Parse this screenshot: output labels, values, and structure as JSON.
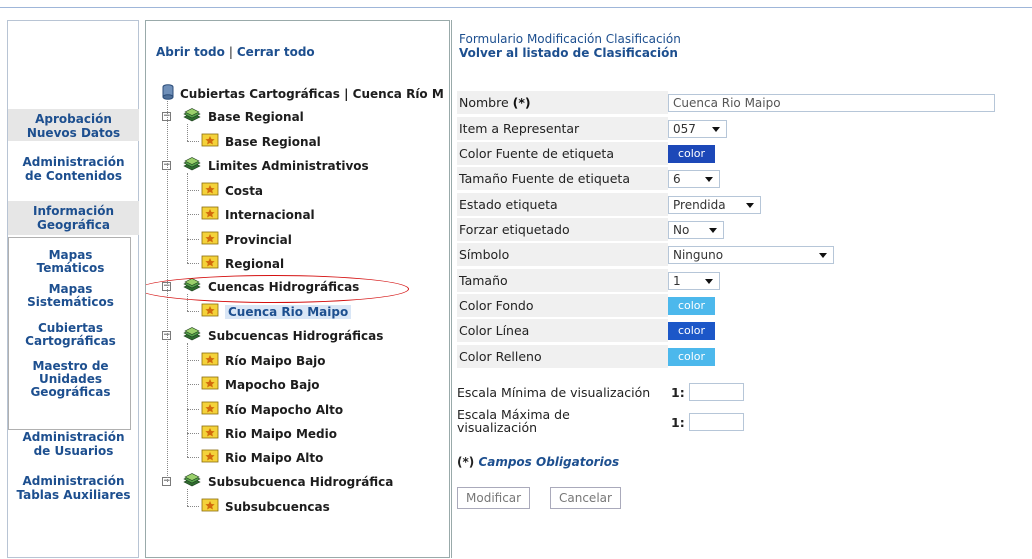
{
  "leftnav": {
    "aprobacion": "Aprobación\nNuevos Datos",
    "admin_contenidos": "Administración\nde Contenidos",
    "info_geo": "Información\nGeográfica",
    "mapas_tematicos": "Mapas\nTemáticos",
    "mapas_sistematicos": "Mapas\nSistemáticos",
    "cubiertas": "Cubiertas\nCartográficas",
    "maestro": "Maestro de\nUnidades\nGeográficas",
    "admin_usuarios": "Administración\nde Usuarios",
    "admin_tablas": "Administración\nTablas Auxiliares"
  },
  "tree": {
    "open_all": "Abrir todo",
    "close_all": "Cerrar todo",
    "separator": "|",
    "root": "Cubiertas Cartográficas | Cuenca Río M",
    "nodes": [
      {
        "label": "Base Regional",
        "level": 1
      },
      {
        "label": "Base Regional",
        "level": 2
      },
      {
        "label": "Limites Administrativos",
        "level": 1
      },
      {
        "label": "Costa",
        "level": 2
      },
      {
        "label": "Internacional",
        "level": 2
      },
      {
        "label": "Provincial",
        "level": 2
      },
      {
        "label": "Regional",
        "level": 2
      },
      {
        "label": "Cuencas Hidrográficas",
        "level": 1
      },
      {
        "label": "Cuenca Rio Maipo",
        "level": 2
      },
      {
        "label": "Subcuencas Hidrográficas",
        "level": 1
      },
      {
        "label": "Río Maipo Bajo",
        "level": 2
      },
      {
        "label": "Mapocho Bajo",
        "level": 2
      },
      {
        "label": "Río Mapocho Alto",
        "level": 2
      },
      {
        "label": "Rio Maipo Medio",
        "level": 2
      },
      {
        "label": "Rio Maipo Alto",
        "level": 2
      },
      {
        "label": "Subsubcuenca Hidrográfica",
        "level": 1
      },
      {
        "label": "Subsubcuencas",
        "level": 2
      }
    ]
  },
  "form": {
    "title": "Formulario Modificación Clasificación",
    "back_link": "Volver al listado de Clasificación",
    "nombre_label": "Nombre",
    "required_mark": "(*)",
    "nombre_value": "Cuenca Rio Maipo",
    "item_label": "Item a Representar",
    "item_value": "057",
    "color_fuente_label": "Color Fuente de etiqueta",
    "tam_fuente_label": "Tamaño Fuente de etiqueta",
    "tam_fuente_value": "6",
    "estado_label": "Estado etiqueta",
    "estado_value": "Prendida",
    "forzar_label": "Forzar etiquetado",
    "forzar_value": "No",
    "simbolo_label": "Símbolo",
    "simbolo_value": "Ninguno",
    "tamano_label": "Tamaño",
    "tamano_value": "1",
    "color_fondo_label": "Color Fondo",
    "color_linea_label": "Color Línea",
    "color_relleno_label": "Color Relleno",
    "swatch_text": "color",
    "escala_min_label": "Escala Mínima de visualización",
    "escala_max_label": "Escala Máxima de\nvisualización",
    "escala_prefix": "1:",
    "oblig_star": "(*)",
    "oblig_text": "Campos Obligatorios",
    "btn_modificar": "Modificar",
    "btn_cancelar": "Cancelar"
  },
  "colors": {
    "color_fuente": "#1c48b8",
    "color_fondo": "#4cb8ec",
    "color_linea": "#1c57c8",
    "color_relleno": "#4cb8ec",
    "accent": "#1d4f8f"
  }
}
